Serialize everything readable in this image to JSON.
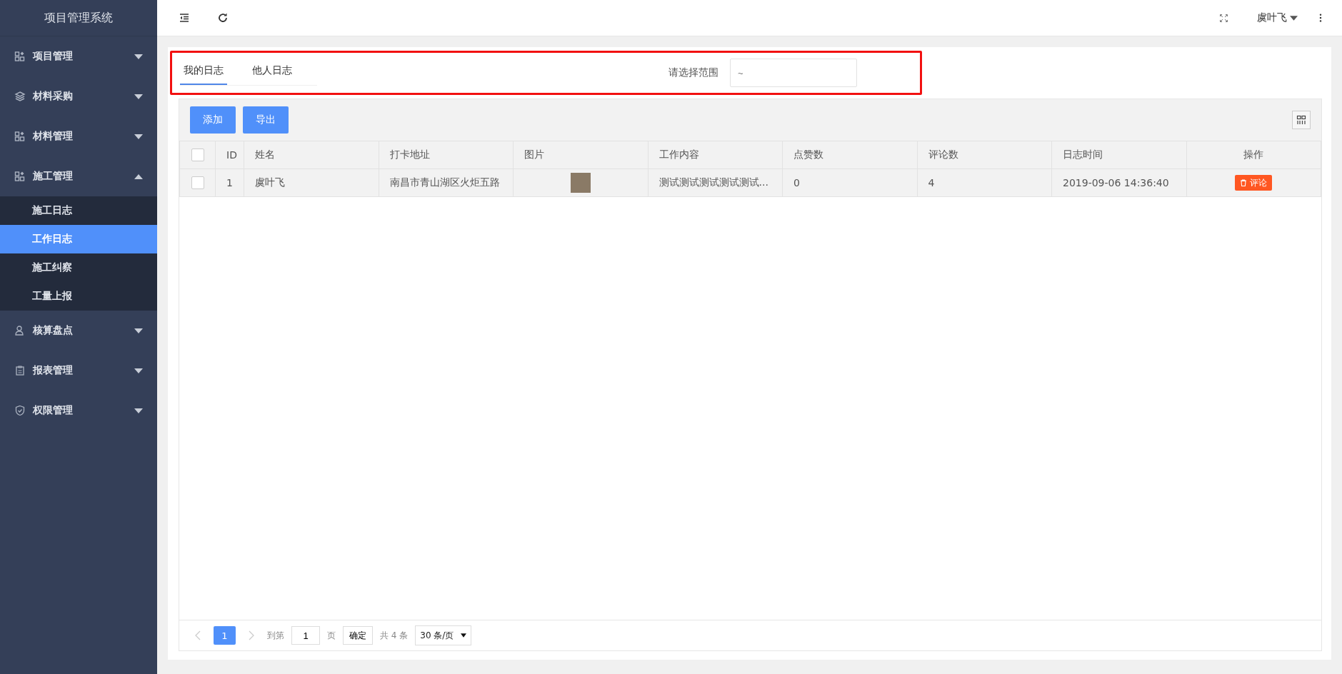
{
  "sidebar": {
    "title": "项目管理系统",
    "menu": [
      {
        "label": "项目管理",
        "expanded": false
      },
      {
        "label": "材料采购",
        "expanded": false
      },
      {
        "label": "材料管理",
        "expanded": false
      },
      {
        "label": "施工管理",
        "expanded": true,
        "children": [
          {
            "label": "施工日志",
            "selected": false
          },
          {
            "label": "工作日志",
            "selected": true
          },
          {
            "label": "施工纠察",
            "selected": false
          },
          {
            "label": "工量上报",
            "selected": false
          }
        ]
      },
      {
        "label": "核算盘点",
        "expanded": false
      },
      {
        "label": "报表管理",
        "expanded": false
      },
      {
        "label": "权限管理",
        "expanded": false
      }
    ]
  },
  "topbar": {
    "user": "虞叶飞"
  },
  "tabs": [
    {
      "label": "我的日志",
      "selected": true
    },
    {
      "label": "他人日志",
      "selected": false
    }
  ],
  "range": {
    "label": "请选择范围",
    "placeholder": "~"
  },
  "toolbar": {
    "buttons": [
      "添加",
      "导出"
    ]
  },
  "table": {
    "columns": [
      "ID",
      "姓名",
      "打卡地址",
      "图片",
      "工作内容",
      "点赞数",
      "评论数",
      "日志时间",
      "操作"
    ],
    "select_all": false,
    "rows": [
      {
        "checked": false,
        "id": "1",
        "name": "虞叶飞",
        "address": "南昌市青山湖区火炬五路",
        "content": "测试测试测试测试测试...",
        "likes": "0",
        "comments": "4",
        "time": "2019-09-06 14:36:40",
        "action": "评论"
      }
    ]
  },
  "pagination": {
    "pages": [
      {
        "label": "1",
        "selected": true
      }
    ],
    "goto_label": "到第",
    "page_value": "1",
    "page_unit": "页",
    "confirm": "确定",
    "total": "共 4 条",
    "page_size": "30 条/页"
  }
}
